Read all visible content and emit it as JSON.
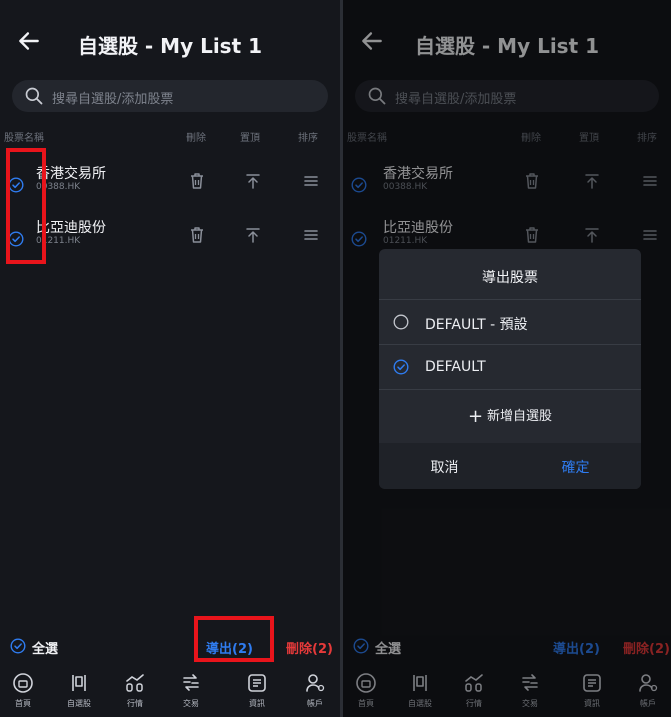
{
  "left_panel": {
    "title": "自選股 - My List 1",
    "search_placeholder": "搜尋自選股/添加股票",
    "columns": {
      "name": "股票名稱",
      "delete": "刪除",
      "top": "置頂",
      "sort": "排序"
    },
    "stocks": [
      {
        "name": "香港交易所",
        "code": "00388.HK",
        "checked": true
      },
      {
        "name": "比亞迪股份",
        "code": "01211.HK",
        "checked": true
      }
    ],
    "select_all_label": "全選",
    "export_label": "導出(2)",
    "delete_label": "刪除(2)",
    "nav": [
      {
        "label": "首頁",
        "icon": "home-icon"
      },
      {
        "label": "自選股",
        "icon": "watchlist-icon"
      },
      {
        "label": "行情",
        "icon": "market-icon"
      },
      {
        "label": "交易",
        "icon": "trade-icon"
      },
      {
        "label": "資訊",
        "icon": "news-icon"
      },
      {
        "label": "帳戶",
        "icon": "account-icon"
      }
    ]
  },
  "right_panel": {
    "title": "自選股 - My List 1",
    "search_placeholder": "搜尋自選股/添加股票",
    "columns": {
      "name": "股票名稱",
      "delete": "刪除",
      "top": "置頂",
      "sort": "排序"
    },
    "stocks": [
      {
        "name": "香港交易所",
        "code": "00388.HK",
        "checked": true
      },
      {
        "name": "比亞迪股份",
        "code": "01211.HK",
        "checked": true
      }
    ],
    "select_all_label": "全選",
    "export_label": "導出(2)",
    "delete_label": "刪除(2)",
    "nav": [
      {
        "label": "首頁",
        "icon": "home-icon"
      },
      {
        "label": "自選股",
        "icon": "watchlist-icon"
      },
      {
        "label": "行情",
        "icon": "market-icon"
      },
      {
        "label": "交易",
        "icon": "trade-icon"
      },
      {
        "label": "資訊",
        "icon": "news-icon"
      },
      {
        "label": "帳戶",
        "icon": "account-icon"
      }
    ],
    "dialog": {
      "title": "導出股票",
      "options": [
        {
          "label": "DEFAULT - 預設",
          "selected": false
        },
        {
          "label": "DEFAULT",
          "selected": true
        }
      ],
      "add_new_label": "新增自選股",
      "cancel_label": "取消",
      "confirm_label": "確定"
    }
  },
  "colors": {
    "background": "#15171c",
    "accent_blue": "#2f7cf0",
    "danger_red": "#e63a3a",
    "highlight_box": "#e8141b"
  }
}
